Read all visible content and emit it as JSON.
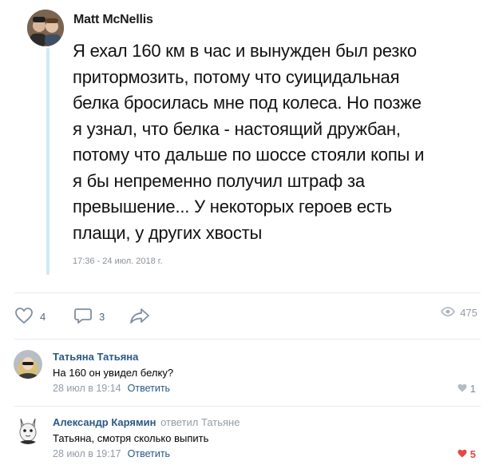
{
  "tweet": {
    "author": "Matt McNellis",
    "text_lines": [
      "Я ехал 160 км в час и вынужден был резко",
      "притормозить, потому что суицидальная",
      "белка бросилась мне под колеса. Но позже",
      "я узнал, что белка  - настоящий дружбан,",
      "потому что дальше по шоссе стояли копы и",
      "я бы непременно получил штраф за",
      "превышение... У некоторых героев есть",
      "плащи, у других хвосты"
    ],
    "date": "17:36 - 24 июл. 2018 г."
  },
  "actions": {
    "likes": "4",
    "comments": "3",
    "views": "475"
  },
  "comments": [
    {
      "author": "Татьяна Татьяна",
      "text": "На 160 он увидел белку?",
      "time": "28 июл в 19:14",
      "reply_label": "Ответить",
      "likes": "1"
    },
    {
      "author": "Александр Карямин",
      "reply_to_word": "ответил",
      "reply_to_name": "Татьяне",
      "text": "Татьяна, смотря сколько выпить",
      "time": "28 июл в 19:17",
      "reply_label": "Ответить",
      "likes": "5"
    }
  ],
  "colors": {
    "link": "#2a5885",
    "muted": "#939ba6",
    "liked": "#e64646",
    "quote_bar": "#cfe9f7"
  }
}
